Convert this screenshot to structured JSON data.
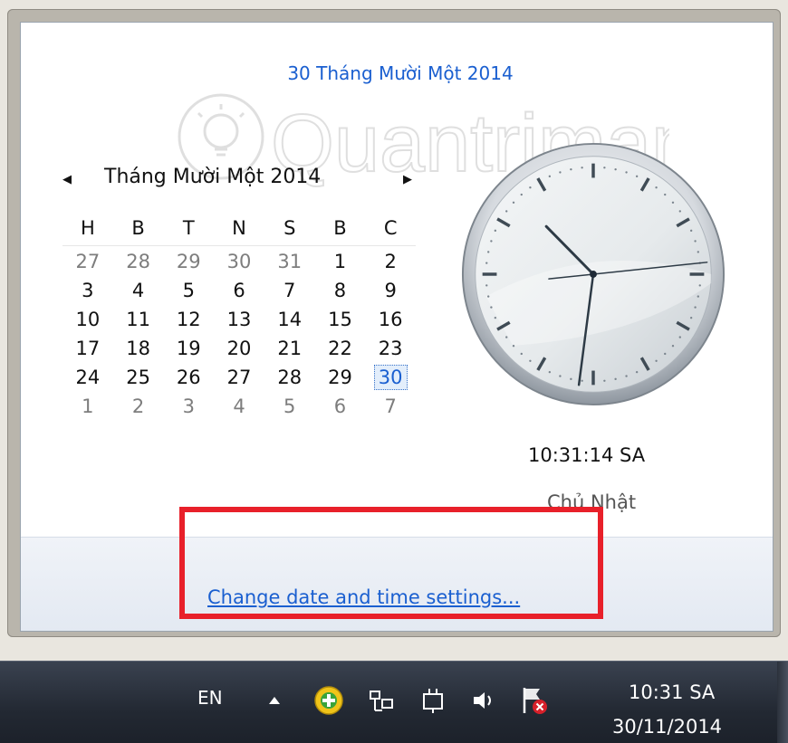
{
  "popup": {
    "full_date": "30 Tháng Mười Một 2014",
    "watermark_text": "Quantrimang"
  },
  "calendar": {
    "prev_icon": "triangle-left-icon",
    "next_icon": "triangle-right-icon",
    "month_title": "Tháng Mười Một 2014",
    "weekdays": [
      "H",
      "B",
      "T",
      "N",
      "S",
      "B",
      "C"
    ],
    "weeks": [
      [
        "27",
        "28",
        "29",
        "30",
        "31",
        "1",
        "2"
      ],
      [
        "3",
        "4",
        "5",
        "6",
        "7",
        "8",
        "9"
      ],
      [
        "10",
        "11",
        "12",
        "13",
        "14",
        "15",
        "16"
      ],
      [
        "17",
        "18",
        "19",
        "20",
        "21",
        "22",
        "23"
      ],
      [
        "24",
        "25",
        "26",
        "27",
        "28",
        "29",
        "30"
      ],
      [
        "1",
        "2",
        "3",
        "4",
        "5",
        "6",
        "7"
      ]
    ],
    "selected_day": "30"
  },
  "clock": {
    "time": "10:31:14 SA",
    "weekday": "Chủ Nhật",
    "hour": 10,
    "minute": 31,
    "second": 14
  },
  "footer": {
    "settings_link": "Change date and time settings..."
  },
  "taskbar": {
    "language": "EN",
    "tray_icons": [
      "show-hidden-icons-arrow-icon",
      "plus-app-icon",
      "network-icon",
      "power-plug-icon",
      "volume-icon",
      "action-center-flag-icon"
    ],
    "time": "10:31 SA",
    "date": "30/11/2014"
  },
  "colors": {
    "link": "#1a5fd0",
    "highlight_box": "#e8202a",
    "taskbar": "#232933"
  }
}
